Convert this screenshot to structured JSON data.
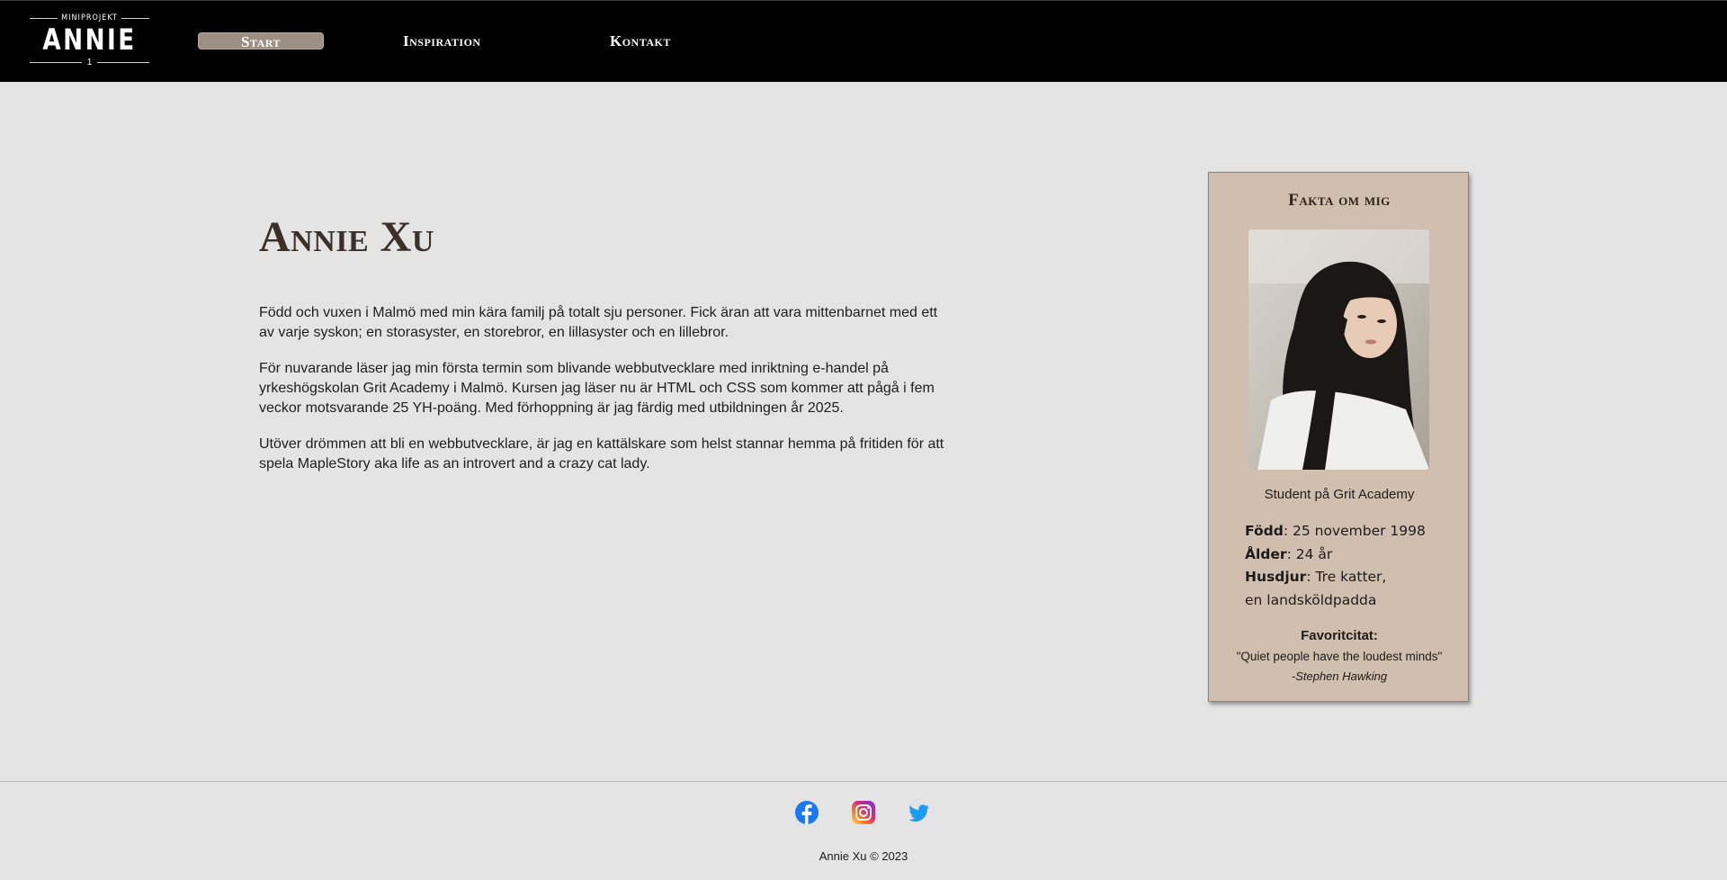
{
  "logo": {
    "top_text": "MINIPROJEKT",
    "main_text": "ANNIE",
    "bottom_text": "1"
  },
  "nav": {
    "items": [
      {
        "label": "Start",
        "active": true
      },
      {
        "label": "Inspiration",
        "active": false
      },
      {
        "label": "Kontakt",
        "active": false
      }
    ]
  },
  "main": {
    "title": "Annie Xu",
    "paragraphs": [
      "Född och vuxen i Malmö med min kära familj på totalt sju personer. Fick äran att vara mittenbarnet med ett av varje syskon; en storasyster, en storebror, en lillasyster och en lillebror.",
      "För nuvarande läser jag min första termin som blivande webbutvecklare med inriktning e-handel på yrkeshögskolan Grit Academy i Malmö. Kursen jag läser nu är HTML och CSS som kommer att pågå i fem veckor motsvarande 25 YH-poäng. Med förhoppning är jag färdig med utbildningen år 2025.",
      "Utöver drömmen att bli en webbutvecklare, är jag en kattälskare som helst stannar hemma på fritiden för att spela MapleStory aka life as an introvert and a crazy cat lady."
    ]
  },
  "card": {
    "title": "Fakta om mig",
    "subtitle": "Student på Grit Academy",
    "facts": [
      {
        "label": "Född",
        "value": "25 november 1998"
      },
      {
        "label": "Ålder",
        "value": "24 år"
      },
      {
        "label": "Husdjur",
        "value": "Tre katter,"
      }
    ],
    "facts_extra_line": "en landsköldpadda",
    "fav_label": "Favoritcitat:",
    "fav_quote": "\"Quiet people have the loudest minds\"",
    "fav_author": "-Stephen Hawking"
  },
  "footer": {
    "social": [
      "facebook-icon",
      "instagram-icon",
      "twitter-icon"
    ],
    "copyright": "Annie Xu © 2023"
  },
  "colors": {
    "header_bg": "#000000",
    "page_bg": "#e3e4e3",
    "nav_active_bg": "#9c8f83",
    "card_bg": "#d0bfae",
    "title_color": "#3d3028"
  }
}
